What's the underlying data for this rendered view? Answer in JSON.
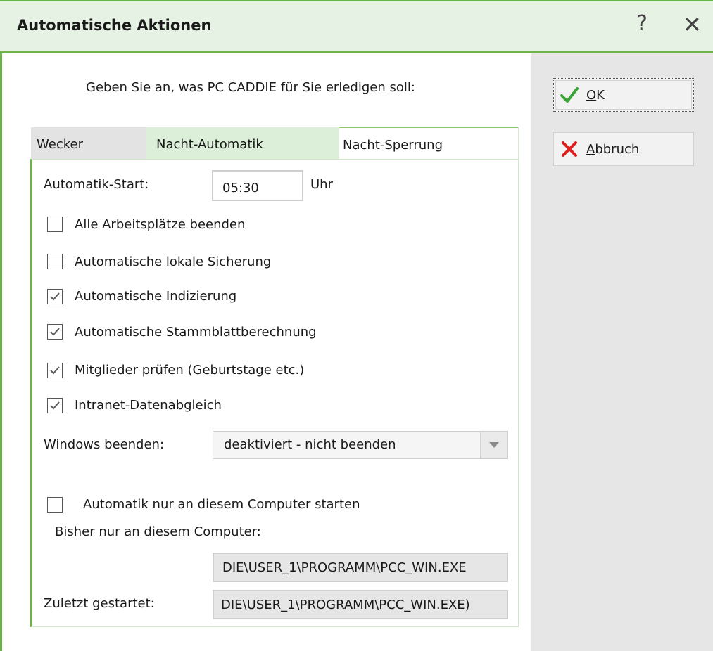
{
  "window": {
    "title": "Automatische Aktionen",
    "help_icon": "?",
    "close_icon": "✕"
  },
  "buttons": {
    "ok_label": "OK",
    "ok_mnemonic": "O",
    "ok_rest": "K",
    "cancel_mnemonic": "A",
    "cancel_rest": "bbruch",
    "ok_icon": "green-check-icon",
    "cancel_icon": "red-x-icon"
  },
  "prompt": "Geben Sie an, was PC CADDIE für Sie erledigen soll:",
  "tabs": [
    {
      "label": "Wecker"
    },
    {
      "label": "Nacht-Automatik"
    },
    {
      "label": "Nacht-Sperrung"
    }
  ],
  "start": {
    "label": "Automatik-Start:",
    "value": "05:30",
    "unit": "Uhr"
  },
  "checkboxes": [
    {
      "label": "Alle Arbeitsplätze beenden",
      "checked": false
    },
    {
      "label": "Automatische lokale Sicherung",
      "checked": false
    },
    {
      "label": "Automatische Indizierung",
      "checked": true
    },
    {
      "label": "Automatische Stammblattberechnung",
      "checked": true
    },
    {
      "label": "Mitglieder prüfen (Geburtstage etc.)",
      "checked": true
    },
    {
      "label": "Intranet-Datenabgleich",
      "checked": true
    }
  ],
  "shutdown": {
    "label": "Windows beenden:",
    "selected": "deaktiviert - nicht beenden"
  },
  "computer_only": {
    "label": "Automatik nur an diesem Computer starten",
    "checked": false,
    "previous_label": "Bisher nur an diesem Computer:",
    "previous_value": "DIE\\USER_1\\PROGRAMM\\PCC_WIN.EXE"
  },
  "last_started": {
    "label": "Zuletzt gestartet:",
    "value": "DIE\\USER_1\\PROGRAMM\\PCC_WIN.EXE)"
  },
  "colors": {
    "accent": "#6cb34a",
    "titlebar_bg": "#e6f2e4",
    "check": "#5a5a5a"
  }
}
